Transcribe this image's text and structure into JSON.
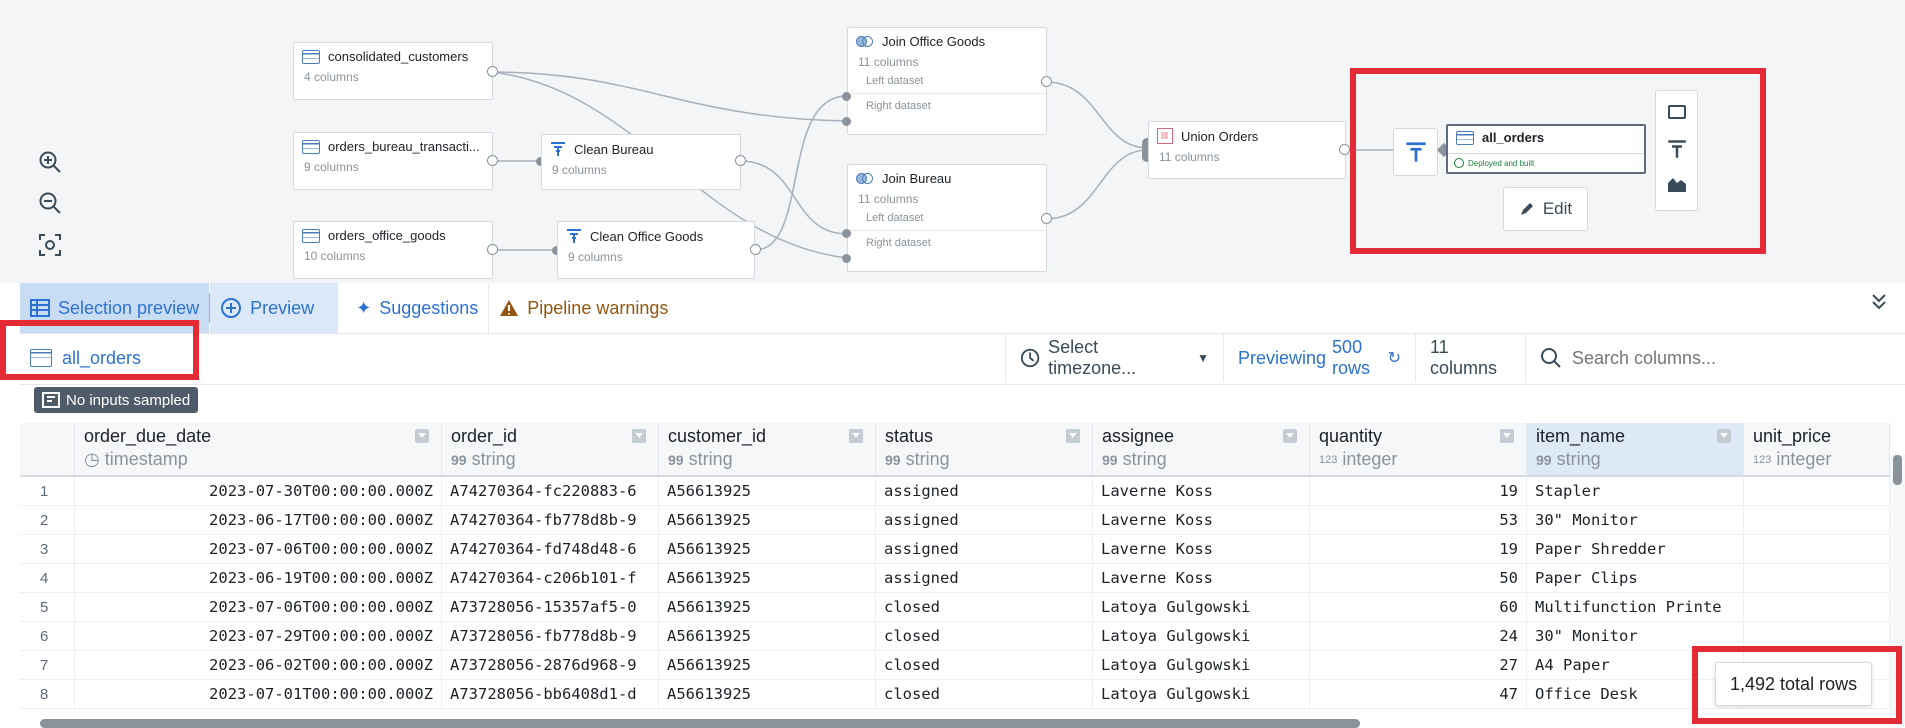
{
  "graph": {
    "nodes": {
      "consolidated_customers": {
        "name": "consolidated_customers",
        "sub": "4 columns"
      },
      "orders_bureau": {
        "name": "orders_bureau_transacti...",
        "sub": "9 columns"
      },
      "orders_office": {
        "name": "orders_office_goods",
        "sub": "10 columns"
      },
      "clean_bureau": {
        "name": "Clean Bureau",
        "sub": "9 columns"
      },
      "clean_office": {
        "name": "Clean Office Goods",
        "sub": "9 columns"
      },
      "join_office": {
        "name": "Join Office Goods",
        "sub": "11 columns",
        "left": "Left dataset",
        "right": "Right dataset"
      },
      "join_bureau": {
        "name": "Join Bureau",
        "sub": "11 columns",
        "left": "Left dataset",
        "right": "Right dataset"
      },
      "union": {
        "name": "Union Orders",
        "sub": "11 columns"
      },
      "all_orders": {
        "name": "all_orders",
        "status": "Deployed and built"
      }
    },
    "edit_label": "Edit",
    "icons": [
      "zoom-in-icon",
      "zoom-out-icon",
      "fit-view-icon",
      "terminal-icon",
      "filter-icon",
      "chart-icon"
    ]
  },
  "tabs": [
    {
      "label": "Selection preview",
      "icon": "table-icon"
    },
    {
      "label": "Preview",
      "icon": "plus-circle-icon"
    },
    {
      "label": "Suggestions",
      "icon": "sparkle-icon"
    },
    {
      "label": "Pipeline warnings",
      "icon": "warning-icon"
    }
  ],
  "toolbar": {
    "dataset": "all_orders",
    "timezone": "Select timezone...",
    "previewing": "Previewing",
    "rows": "500 rows",
    "columns": "11 columns",
    "search_placeholder": "Search columns..."
  },
  "badge": "No inputs sampled",
  "table": {
    "columns": [
      {
        "name": "order_due_date",
        "type": "timestamp",
        "type_icon": "clock-icon"
      },
      {
        "name": "order_id",
        "type": "string",
        "type_icon": "99"
      },
      {
        "name": "customer_id",
        "type": "string",
        "type_icon": "99"
      },
      {
        "name": "status",
        "type": "string",
        "type_icon": "99"
      },
      {
        "name": "assignee",
        "type": "string",
        "type_icon": "99"
      },
      {
        "name": "quantity",
        "type": "integer",
        "type_icon": "123"
      },
      {
        "name": "item_name",
        "type": "string",
        "type_icon": "99"
      },
      {
        "name": "unit_price",
        "type": "integer",
        "type_icon": "123"
      }
    ],
    "rows": [
      [
        "1",
        "2023-07-30T00:00:00.000Z",
        "A74270364-fc220883-6",
        "A56613925",
        "assigned",
        "Laverne Koss",
        "19",
        "Stapler",
        ""
      ],
      [
        "2",
        "2023-06-17T00:00:00.000Z",
        "A74270364-fb778d8b-9",
        "A56613925",
        "assigned",
        "Laverne Koss",
        "53",
        "30\" Monitor",
        ""
      ],
      [
        "3",
        "2023-07-06T00:00:00.000Z",
        "A74270364-fd748d48-6",
        "A56613925",
        "assigned",
        "Laverne Koss",
        "19",
        "Paper Shredder",
        ""
      ],
      [
        "4",
        "2023-06-19T00:00:00.000Z",
        "A74270364-c206b101-f",
        "A56613925",
        "assigned",
        "Laverne Koss",
        "50",
        "Paper Clips",
        ""
      ],
      [
        "5",
        "2023-07-06T00:00:00.000Z",
        "A73728056-15357af5-0",
        "A56613925",
        "closed",
        "Latoya Gulgowski",
        "60",
        "Multifunction Printe",
        ""
      ],
      [
        "6",
        "2023-07-29T00:00:00.000Z",
        "A73728056-fb778d8b-9",
        "A56613925",
        "closed",
        "Latoya Gulgowski",
        "24",
        "30\" Monitor",
        ""
      ],
      [
        "7",
        "2023-06-02T00:00:00.000Z",
        "A73728056-2876d968-9",
        "A56613925",
        "closed",
        "Latoya Gulgowski",
        "27",
        "A4 Paper",
        ""
      ],
      [
        "8",
        "2023-07-01T00:00:00.000Z",
        "A73728056-bb6408d1-d",
        "A56613925",
        "closed",
        "Latoya Gulgowski",
        "47",
        "Office Desk",
        ""
      ]
    ],
    "total_rows": "1,492 total rows"
  }
}
